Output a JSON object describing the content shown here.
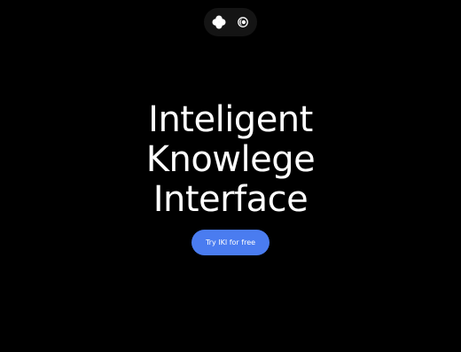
{
  "nav": {
    "logo_icon": "clover-logo-icon",
    "theme_icon": "theme-toggle-icon"
  },
  "hero": {
    "lines": [
      "Inteligent",
      "Knowlege",
      "Interface"
    ]
  },
  "cta": {
    "label": "Try IKI for free"
  },
  "colors": {
    "background": "#000000",
    "nav_pill": "#141414",
    "text": "#ffffff",
    "accent": "#4a7cf0"
  }
}
